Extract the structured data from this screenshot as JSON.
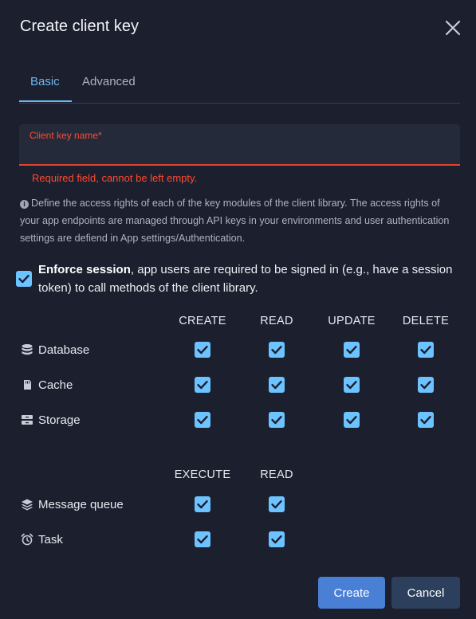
{
  "dialog": {
    "title": "Create client key",
    "close_icon": "close-icon"
  },
  "tabs": [
    {
      "label": "Basic",
      "active": true
    },
    {
      "label": "Advanced",
      "active": false
    }
  ],
  "name_field": {
    "label": "Client key name",
    "required_mark": "*",
    "value": "",
    "error": "Required field, cannot be left empty."
  },
  "info": {
    "icon": "info-icon",
    "text": "Define the access rights of each of the key modules of the client library. The access rights of your app endpoints are managed through API keys in your environments and user authentication settings are defiend in App settings/Authentication."
  },
  "enforce": {
    "checked": true,
    "bold": "Enforce session",
    "text": ", app users are required to be signed in (e.g., have a session token) to call methods of the client library."
  },
  "crud": {
    "columns": [
      "CREATE",
      "READ",
      "UPDATE",
      "DELETE"
    ],
    "rows": [
      {
        "label": "Database",
        "icon": "database-icon",
        "checks": [
          true,
          true,
          true,
          true
        ]
      },
      {
        "label": "Cache",
        "icon": "cache-icon",
        "checks": [
          true,
          true,
          true,
          true
        ]
      },
      {
        "label": "Storage",
        "icon": "storage-icon",
        "checks": [
          true,
          true,
          true,
          true
        ]
      }
    ]
  },
  "exec": {
    "columns": [
      "EXECUTE",
      "READ"
    ],
    "rows": [
      {
        "label": "Message queue",
        "icon": "layers-icon",
        "checks": [
          true,
          true
        ]
      },
      {
        "label": "Task",
        "icon": "alarm-clock-icon",
        "checks": [
          true,
          true
        ]
      }
    ]
  },
  "buttons": {
    "create": "Create",
    "cancel": "Cancel"
  },
  "colors": {
    "background": "#1b1f2e",
    "accent": "#6cb7f2",
    "checkbox": "#6cc3ff",
    "error": "#ff4a32",
    "primary_button": "#4a7fd6",
    "secondary_button": "#2c3f5c"
  }
}
